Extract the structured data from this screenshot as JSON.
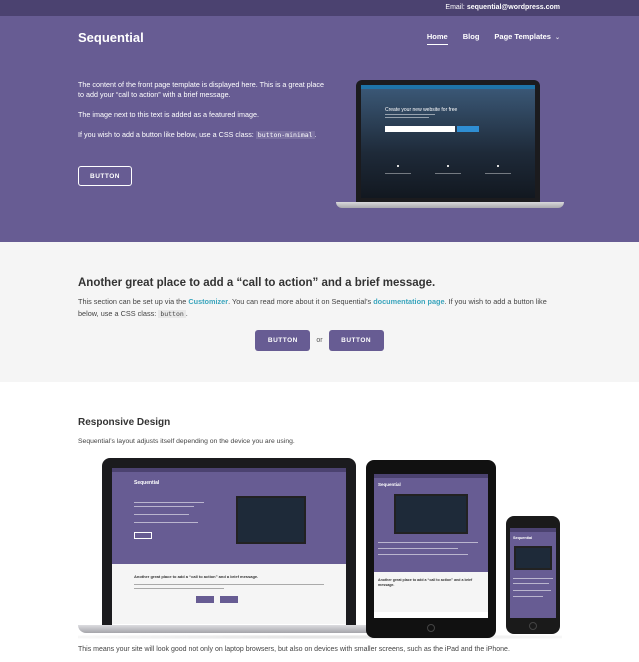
{
  "topbar": {
    "email_label": "Email:",
    "email": "sequential@wordpress.com"
  },
  "header": {
    "logo": "Sequential",
    "nav": [
      {
        "label": "Home",
        "active": true
      },
      {
        "label": "Blog",
        "active": false
      },
      {
        "label": "Page Templates",
        "active": false,
        "has_dropdown": true
      }
    ]
  },
  "hero": {
    "paragraph1": "The content of the front page template is displayed here. This is a great place to add your “call to action” with a brief message.",
    "paragraph2": "The image next to this text is added as a featured image.",
    "paragraph3_before": "If you wish to add a button like below, use a CSS class:",
    "paragraph3_code": "button-minimal",
    "paragraph3_after": ".",
    "button_label": "BUTTON",
    "featured_screen_title": "Create your new website for free"
  },
  "cta": {
    "title": "Another great place to add a “call to action” and a brief message.",
    "desc_part1": "This section can be set up via the",
    "link_customizer": "Customizer",
    "desc_part2": ". You can read more about it on Sequential’s",
    "link_docs": "documentation page",
    "desc_part3": ". If you wish to add a button like below, use a CSS class:",
    "desc_code": "button",
    "desc_part4": ".",
    "button1_label": "BUTTON",
    "or_label": "or",
    "button2_label": "BUTTON"
  },
  "responsive": {
    "title": "Responsive Design",
    "description": "Sequential’s layout adjusts itself depending on the device you are using.",
    "mini_logo": "Sequential",
    "mini_cta_title": "Another great place to add a “call to action” and a brief message.",
    "footnote": "This means your site will look good not only on laptop browsers, but also on devices with smaller screens, such as the iPad and the iPhone."
  },
  "colors": {
    "brand_purple": "#675c93",
    "topbar": "#4b4270",
    "link": "#3aa5bd"
  },
  "icons": [
    "chevron-down-icon"
  ]
}
